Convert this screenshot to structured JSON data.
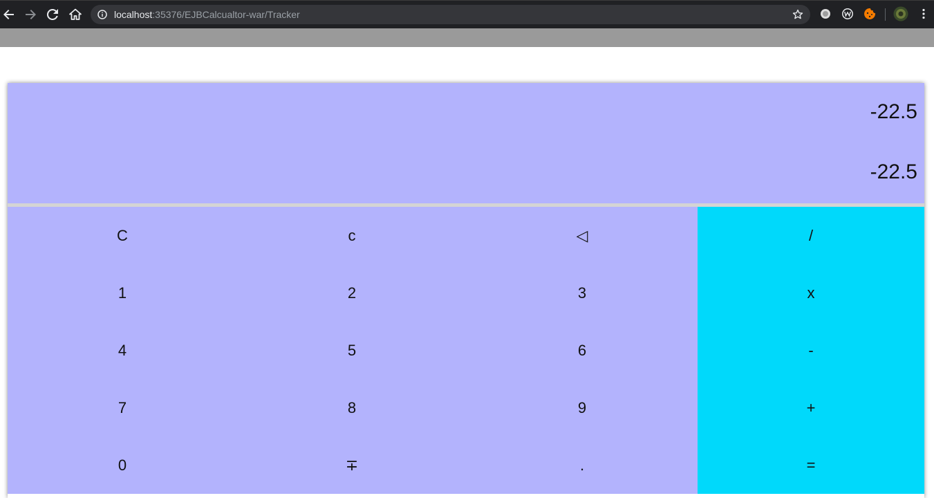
{
  "browser": {
    "url_host": "localhost",
    "url_path": ":35376/EJBCalcualtor-war/Tracker",
    "icons": [
      "back-icon",
      "forward-icon",
      "reload-icon",
      "home-icon",
      "info-icon",
      "star-icon",
      "extension-icon",
      "extension-w-icon",
      "extension-cookie-icon",
      "profile-avatar",
      "menu-icon"
    ]
  },
  "calculator": {
    "expression": "-22.5",
    "result": "-22.5",
    "keys": [
      {
        "label": "C",
        "name": "clear-all-button",
        "op": false
      },
      {
        "label": "c",
        "name": "clear-entry-button",
        "op": false
      },
      {
        "label": "◁",
        "name": "backspace-button",
        "op": false
      },
      {
        "label": "/",
        "name": "divide-button",
        "op": true
      },
      {
        "label": "1",
        "name": "digit-1-button",
        "op": false
      },
      {
        "label": "2",
        "name": "digit-2-button",
        "op": false
      },
      {
        "label": "3",
        "name": "digit-3-button",
        "op": false
      },
      {
        "label": "x",
        "name": "multiply-button",
        "op": true
      },
      {
        "label": "4",
        "name": "digit-4-button",
        "op": false
      },
      {
        "label": "5",
        "name": "digit-5-button",
        "op": false
      },
      {
        "label": "6",
        "name": "digit-6-button",
        "op": false
      },
      {
        "label": "-",
        "name": "subtract-button",
        "op": true
      },
      {
        "label": "7",
        "name": "digit-7-button",
        "op": false
      },
      {
        "label": "8",
        "name": "digit-8-button",
        "op": false
      },
      {
        "label": "9",
        "name": "digit-9-button",
        "op": false
      },
      {
        "label": "+",
        "name": "add-button",
        "op": true
      },
      {
        "label": "0",
        "name": "digit-0-button",
        "op": false
      },
      {
        "label": "∓",
        "name": "negate-button",
        "op": false
      },
      {
        "label": ".",
        "name": "decimal-button",
        "op": false
      },
      {
        "label": "=",
        "name": "equals-button",
        "op": true
      }
    ],
    "colors": {
      "panel": "#b3b3fd",
      "operator": "#00d9fb",
      "divider": "#d4d4d4"
    }
  }
}
